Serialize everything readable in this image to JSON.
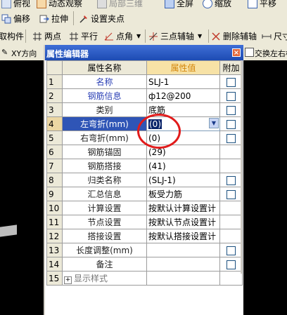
{
  "toolbar1": {
    "items": [
      "俯视",
      "动态观察",
      "局部三维",
      "全屏",
      "缩放",
      "平移"
    ]
  },
  "toolbar2": {
    "offset_label": "偏移",
    "stretch_label": "拉伸",
    "set_pin_label": "设置夹点"
  },
  "toolbar3": {
    "component_label": "取构件",
    "two_point_label": "两点",
    "parallel_label": "平行",
    "point_angle_label": "点角",
    "three_point_label": "三点辅轴",
    "delete_label": "删除辅轴",
    "dimension_label": "尺寸"
  },
  "right_bar": {
    "swap_label": "交换左右标"
  },
  "left_bar": {
    "xy_label": "XY方向"
  },
  "panel": {
    "title": "属性编辑器",
    "close_glyph": "×",
    "columns": {
      "num": "",
      "name": "属性名称",
      "value": "属性值",
      "extra": "附加"
    },
    "rows": [
      {
        "num": "1",
        "name": "名称",
        "value": "SLJ-1",
        "check": false,
        "style": "blue"
      },
      {
        "num": "2",
        "name": "钢筋信息",
        "value": "ф12@200",
        "check": true,
        "style": "blue"
      },
      {
        "num": "3",
        "name": "类别",
        "value": "底筋",
        "check": true,
        "style": "dark"
      },
      {
        "num": "4",
        "name": "左弯折(mm)",
        "value": "(0)",
        "check": true,
        "style": "selected"
      },
      {
        "num": "5",
        "name": "右弯折(mm)",
        "value": "(0)",
        "check": true,
        "style": "dark"
      },
      {
        "num": "6",
        "name": "钢筋锚固",
        "value": "(29)",
        "check": null,
        "style": "dark"
      },
      {
        "num": "7",
        "name": "钢筋搭接",
        "value": "(41)",
        "check": null,
        "style": "dark"
      },
      {
        "num": "8",
        "name": "归类名称",
        "value": "(SLJ-1)",
        "check": true,
        "style": "dark"
      },
      {
        "num": "9",
        "name": "汇总信息",
        "value": "板受力筋",
        "check": true,
        "style": "dark"
      },
      {
        "num": "10",
        "name": "计算设置",
        "value": "按默认计算设置计",
        "check": null,
        "style": "dark"
      },
      {
        "num": "11",
        "name": "节点设置",
        "value": "按默认节点设置计",
        "check": null,
        "style": "dark"
      },
      {
        "num": "12",
        "name": "搭接设置",
        "value": "按默认搭接设置计",
        "check": null,
        "style": "dark"
      },
      {
        "num": "13",
        "name": "长度调整(mm)",
        "value": "",
        "check": true,
        "style": "dark"
      },
      {
        "num": "14",
        "name": "备注",
        "value": "",
        "check": true,
        "style": "dark"
      },
      {
        "num": "15",
        "name": "显示样式",
        "value": "",
        "check": null,
        "style": "group"
      }
    ]
  },
  "colors": {
    "title_bar": "#1d4bb3",
    "selected_row": "#2f55b6",
    "header_value_bg": "#f7e2a6",
    "annotation_circle": "#e11b1b"
  }
}
